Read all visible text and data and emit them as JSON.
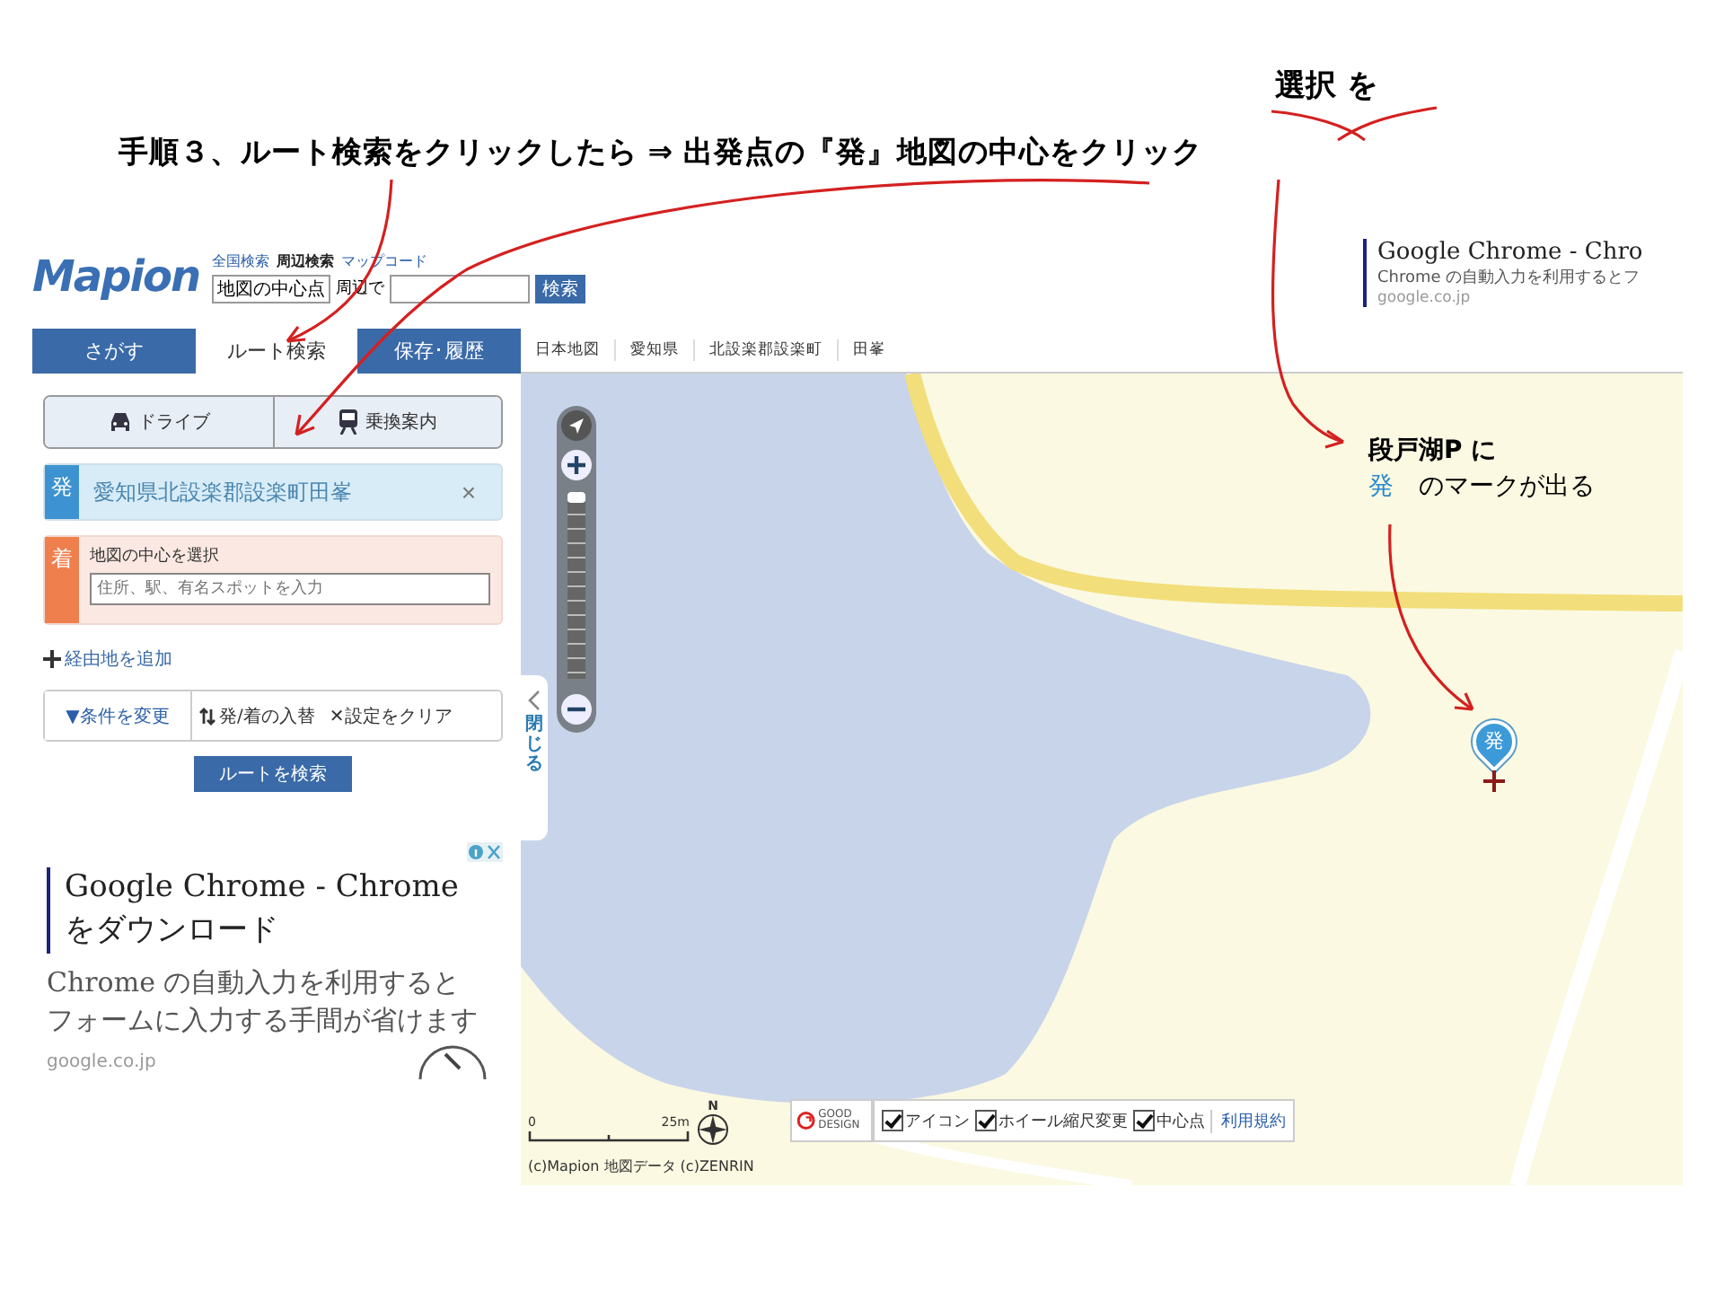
{
  "annotations": {
    "top_note": "選択 を",
    "title": "手順３、ルート検索をクリックしたら ⇒ 出発点の『発』地図の中心をクリック",
    "map_note": {
      "line_1": "段戸湖P に",
      "marker_word": "発",
      "line_2_rest": "のマークが出る"
    }
  },
  "header": {
    "logo": "Mapion",
    "search_modes": [
      {
        "label": "全国検索",
        "selected": false
      },
      {
        "label": "周辺検索",
        "selected": true
      },
      {
        "label": "マップコード",
        "selected": false
      }
    ],
    "place_field": "地図の中心点",
    "around_label": "周辺で",
    "search_button": "検索"
  },
  "header_ad": {
    "title": "Google Chrome - Chro",
    "body": "Chrome の自動入力を利用するとフ",
    "url": "google.co.jp"
  },
  "tabs": [
    {
      "label": "さがす",
      "selected": false
    },
    {
      "label": "ルート検索",
      "selected": true
    },
    {
      "label": "保存･履歴",
      "selected": false
    }
  ],
  "route_modes": [
    {
      "label": "ドライブ",
      "kind": "car"
    },
    {
      "label": "乗換案内",
      "kind": "train"
    }
  ],
  "origin": {
    "badge": "発",
    "value": "愛知県北設楽郡設楽町田峯",
    "clear": "×"
  },
  "destination": {
    "badge": "着",
    "label": "地図の中心を選択",
    "placeholder": "住所、駅、有名スポットを入力"
  },
  "add_waypoint": "経由地を追加",
  "route_options": [
    {
      "label": "▼条件を変更",
      "kind": "plain"
    },
    {
      "label": "発/着の入替",
      "kind": "swap"
    },
    {
      "label": "✕設定をクリア",
      "kind": "plain"
    }
  ],
  "search_route_button": "ルートを検索",
  "side_ad": {
    "title": "Google Chrome - Chrome をダウンロード",
    "body": "Chrome の自動入力を利用するとフォームに入力する手間が省けます",
    "url": "google.co.jp"
  },
  "breadcrumbs": [
    "日本地図",
    "愛知県",
    "北設楽郡設楽町",
    "田峯"
  ],
  "close_panel": "閉じる",
  "map": {
    "zoom": {
      "level": 0.97
    },
    "marker": "発",
    "scale_start": "0",
    "scale_end": "25m",
    "compass": "N",
    "copyright": "(c)Mapion 地図データ (c)ZENRIN",
    "good_design": "GOOD DESIGN",
    "options": [
      {
        "label": "アイコン",
        "checked": true
      },
      {
        "label": "ホイール縮尺変更",
        "checked": true
      },
      {
        "label": "中心点",
        "checked": true
      }
    ],
    "terms_link": "利用規約"
  }
}
